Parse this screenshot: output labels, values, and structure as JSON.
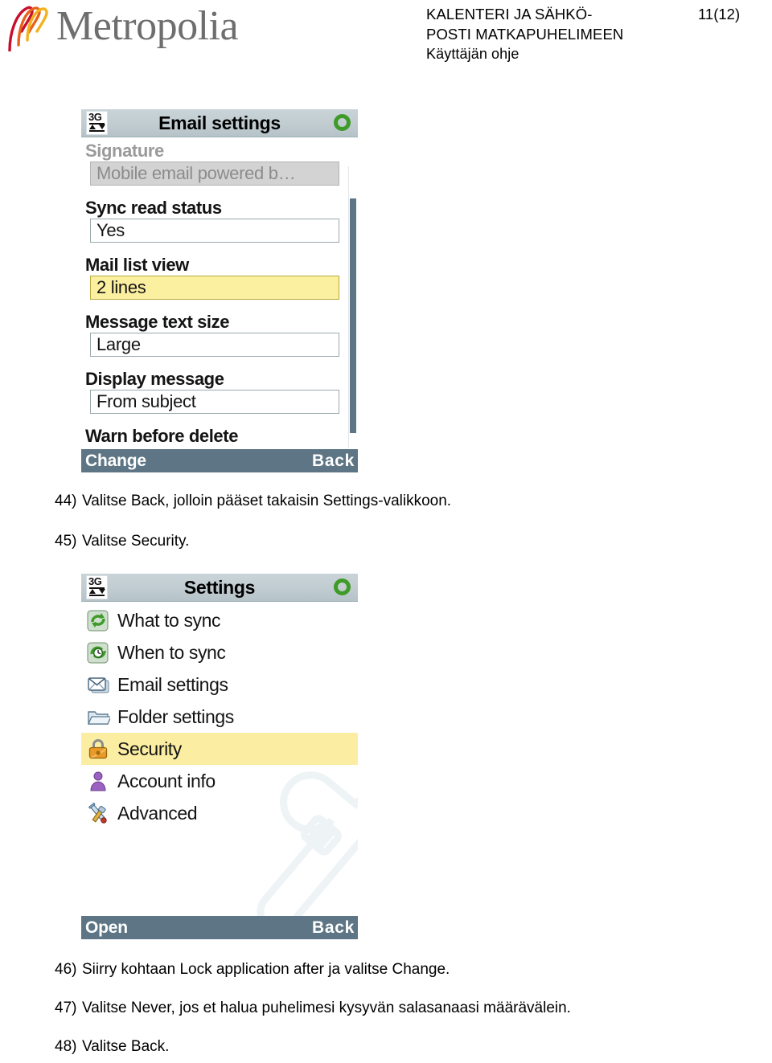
{
  "header": {
    "logo_text": "Metropolia",
    "doc_title_line1": "KALENTERI JA SÄHKÖ-",
    "doc_title_line2": "POSTI MATKAPUHELIMEEN",
    "doc_subtitle": "Käyttäjän ohje",
    "page_number": "11(12)"
  },
  "colors": {
    "logo_gray": "#6e6e6e",
    "logo_orange": "#e8621b",
    "logo_yellow": "#f2b21c",
    "logo_red": "#c8102e",
    "titlebar_bg": "#c1ccd1",
    "softkey_bg": "#5d7584",
    "selection_yellow": "#fbeea2",
    "field_selected_yellow": "#fbefa0",
    "scrollbar_thumb": "#5d7584",
    "status_ring_green": "#3f9b28"
  },
  "screenshot_email_settings": {
    "statusbar_icon": "3g-signal-icon",
    "title": "Email settings",
    "status_ring_icon": "green-ring-icon",
    "fields": [
      {
        "label": "Signature",
        "value": "Mobile email powered b…",
        "state": "disabled"
      },
      {
        "label": "Sync read status",
        "value": "Yes",
        "state": "normal"
      },
      {
        "label": "Mail list view",
        "value": "2 lines",
        "state": "selected"
      },
      {
        "label": "Message text size",
        "value": "Large",
        "state": "normal"
      },
      {
        "label": "Display message",
        "value": "From subject",
        "state": "normal"
      },
      {
        "label": "Warn before delete",
        "value": "",
        "state": "clipped"
      }
    ],
    "softkey_left": "Change",
    "softkey_right": "Back"
  },
  "screenshot_settings_menu": {
    "statusbar_icon": "3g-signal-icon",
    "title": "Settings",
    "status_ring_icon": "green-ring-icon",
    "items": [
      {
        "label": "What to sync",
        "icon": "sync-refresh-icon",
        "selected": false
      },
      {
        "label": "When to sync",
        "icon": "sync-clock-icon",
        "selected": false
      },
      {
        "label": "Email settings",
        "icon": "envelope-icon",
        "selected": false
      },
      {
        "label": "Folder settings",
        "icon": "folder-icon",
        "selected": false
      },
      {
        "label": "Security",
        "icon": "padlock-icon",
        "selected": true
      },
      {
        "label": "Account info",
        "icon": "person-icon",
        "selected": false
      },
      {
        "label": "Advanced",
        "icon": "tools-icon",
        "selected": false
      }
    ],
    "softkey_left": "Open",
    "softkey_right": "Back"
  },
  "steps_middle": [
    {
      "num": "44)",
      "text": "Valitse Back, jolloin pääset takaisin Settings-valikkoon."
    },
    {
      "num": "45)",
      "text": "Valitse Security."
    }
  ],
  "steps_bottom": [
    {
      "num": "46)",
      "text": "Siirry kohtaan Lock application after ja valitse Change."
    },
    {
      "num": "47)",
      "text": "Valitse Never, jos et halua puhelimesi kysyvän salasanaasi määrävälein."
    },
    {
      "num": "48)",
      "text": "Valitse Back."
    }
  ]
}
